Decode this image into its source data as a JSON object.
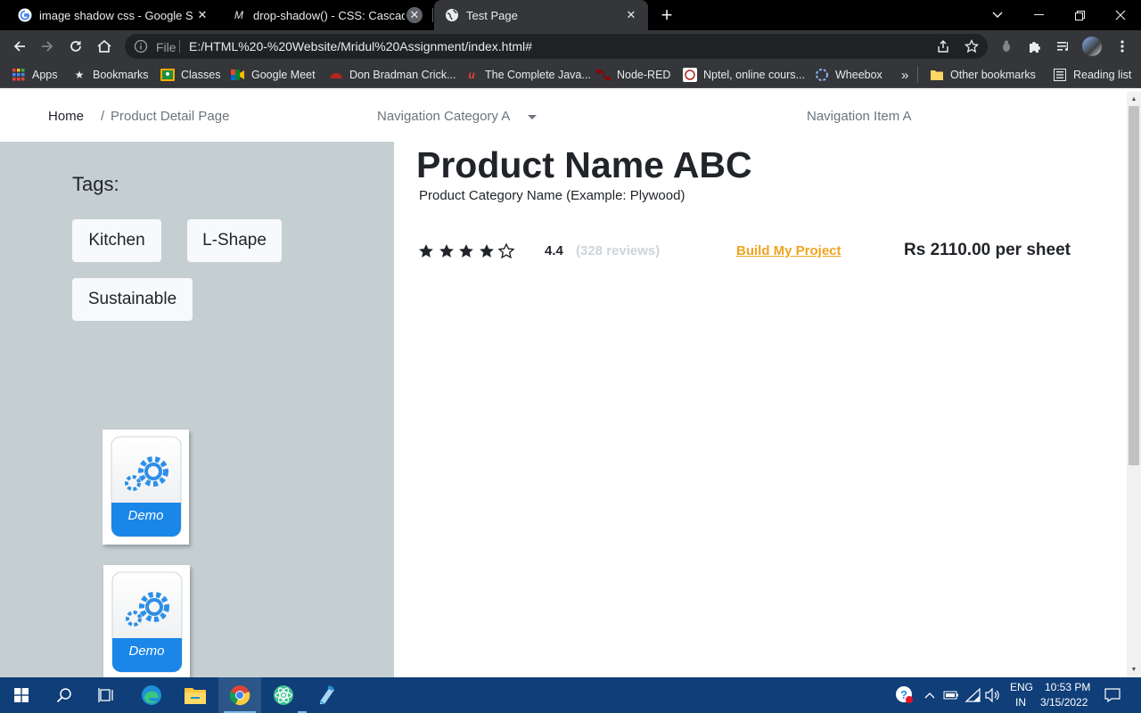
{
  "browser": {
    "tabs": [
      {
        "title": "image shadow css - Google Search",
        "icon": "google-icon"
      },
      {
        "title": "drop-shadow() - CSS: Cascading",
        "icon": "mdn-icon"
      },
      {
        "title": "Test Page",
        "icon": "globe-icon",
        "active": true
      }
    ],
    "new_tab_symbol": "+",
    "omnibox": {
      "protocol": "File",
      "url": "E:/HTML%20-%20Website/Mridul%20Assignment/index.html#"
    },
    "bookmarks": [
      {
        "label": "Apps",
        "icon": "apps-grid-icon"
      },
      {
        "label": "Bookmarks",
        "icon": "star-icon"
      },
      {
        "label": "Classes",
        "icon": "classroom-icon"
      },
      {
        "label": "Google Meet",
        "icon": "meet-icon"
      },
      {
        "label": "Don Bradman Crick...",
        "icon": "cricket-icon"
      },
      {
        "label": "The Complete Java...",
        "icon": "udemy-icon"
      },
      {
        "label": "Node-RED",
        "icon": "node-red-icon"
      },
      {
        "label": "Nptel, online cours...",
        "icon": "nptel-icon"
      },
      {
        "label": "Wheebox",
        "icon": "wheebox-icon"
      }
    ],
    "overflow_symbol": "»",
    "other_bookmarks": "Other bookmarks",
    "reading_list": "Reading list"
  },
  "page": {
    "breadcrumb": {
      "home": "Home",
      "separator": "/",
      "current": "Product Detail Page"
    },
    "nav": {
      "category": "Navigation Category A",
      "item": "Navigation Item A"
    },
    "sidebar": {
      "tags_title": "Tags:",
      "tags": [
        "Kitchen",
        "L-Shape",
        "Sustainable"
      ],
      "demo_label": "Demo"
    },
    "product": {
      "name": "Product Name ABC",
      "category": "Product Category Name (Example: Plywood)",
      "stars_filled": 4,
      "stars_total": 5,
      "rating": "4.4",
      "reviews": "(328 reviews)",
      "build_link": "Build My Project",
      "price": "Rs 2110.00 per sheet"
    }
  },
  "taskbar": {
    "apps": [
      "windows-start-icon",
      "search-icon",
      "task-view-icon",
      "edge-icon",
      "file-explorer-icon",
      "chrome-icon",
      "atom-icon",
      "notepad-icon"
    ],
    "lang_line1": "ENG",
    "lang_line2": "IN",
    "time": "10:53 PM",
    "date": "3/15/2022"
  },
  "colors": {
    "sidebar_bg": "#c5cfd2",
    "build_link": "#f0a41f",
    "taskbar_bg": "#0f3e78",
    "chrome_tab_bg": "#35363a",
    "chrome_frame_bg": "#000000"
  }
}
